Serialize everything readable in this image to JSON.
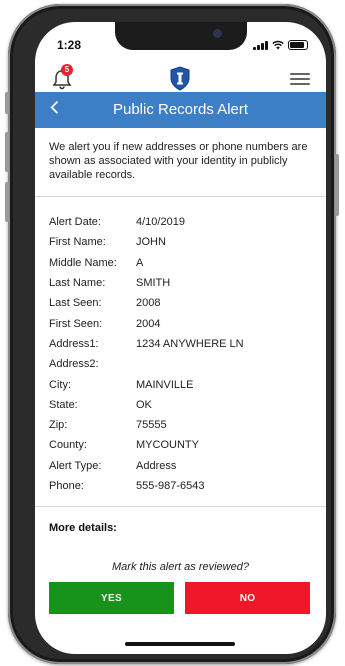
{
  "status_bar": {
    "time": "1:28"
  },
  "header": {
    "notification_count": "5"
  },
  "title_bar": {
    "back_label": "<",
    "title": "Public Records Alert"
  },
  "intro_text": "We alert you if new addresses or phone numbers are shown as associated with your identity in publicly available records.",
  "details": [
    {
      "label": "Alert Date:",
      "value": "4/10/2019"
    },
    {
      "label": "First Name:",
      "value": "JOHN"
    },
    {
      "label": "Middle Name:",
      "value": "A"
    },
    {
      "label": "Last Name:",
      "value": "SMITH"
    },
    {
      "label": "Last Seen:",
      "value": "2008"
    },
    {
      "label": "First Seen:",
      "value": "2004"
    },
    {
      "label": "Address1:",
      "value": "1234 ANYWHERE LN"
    },
    {
      "label": "Address2:",
      "value": ""
    },
    {
      "label": "City:",
      "value": "MAINVILLE"
    },
    {
      "label": "State:",
      "value": "OK"
    },
    {
      "label": "Zip:",
      "value": "75555"
    },
    {
      "label": "County:",
      "value": "MYCOUNTY"
    },
    {
      "label": "Alert Type:",
      "value": "Address"
    },
    {
      "label": "Phone:",
      "value": "555-987-6543"
    }
  ],
  "more_details_label": "More details:",
  "review_prompt": "Mark this alert as reviewed?",
  "buttons": {
    "yes": "YES",
    "no": "NO"
  },
  "colors": {
    "title_bar": "#3d7fc7",
    "yes": "#17921a",
    "no": "#f0172a",
    "badge": "#e8212f"
  },
  "icons": {
    "bell": "bell-icon",
    "logo": "shield-logo-icon",
    "menu": "hamburger-menu-icon",
    "back": "chevron-left-icon"
  }
}
